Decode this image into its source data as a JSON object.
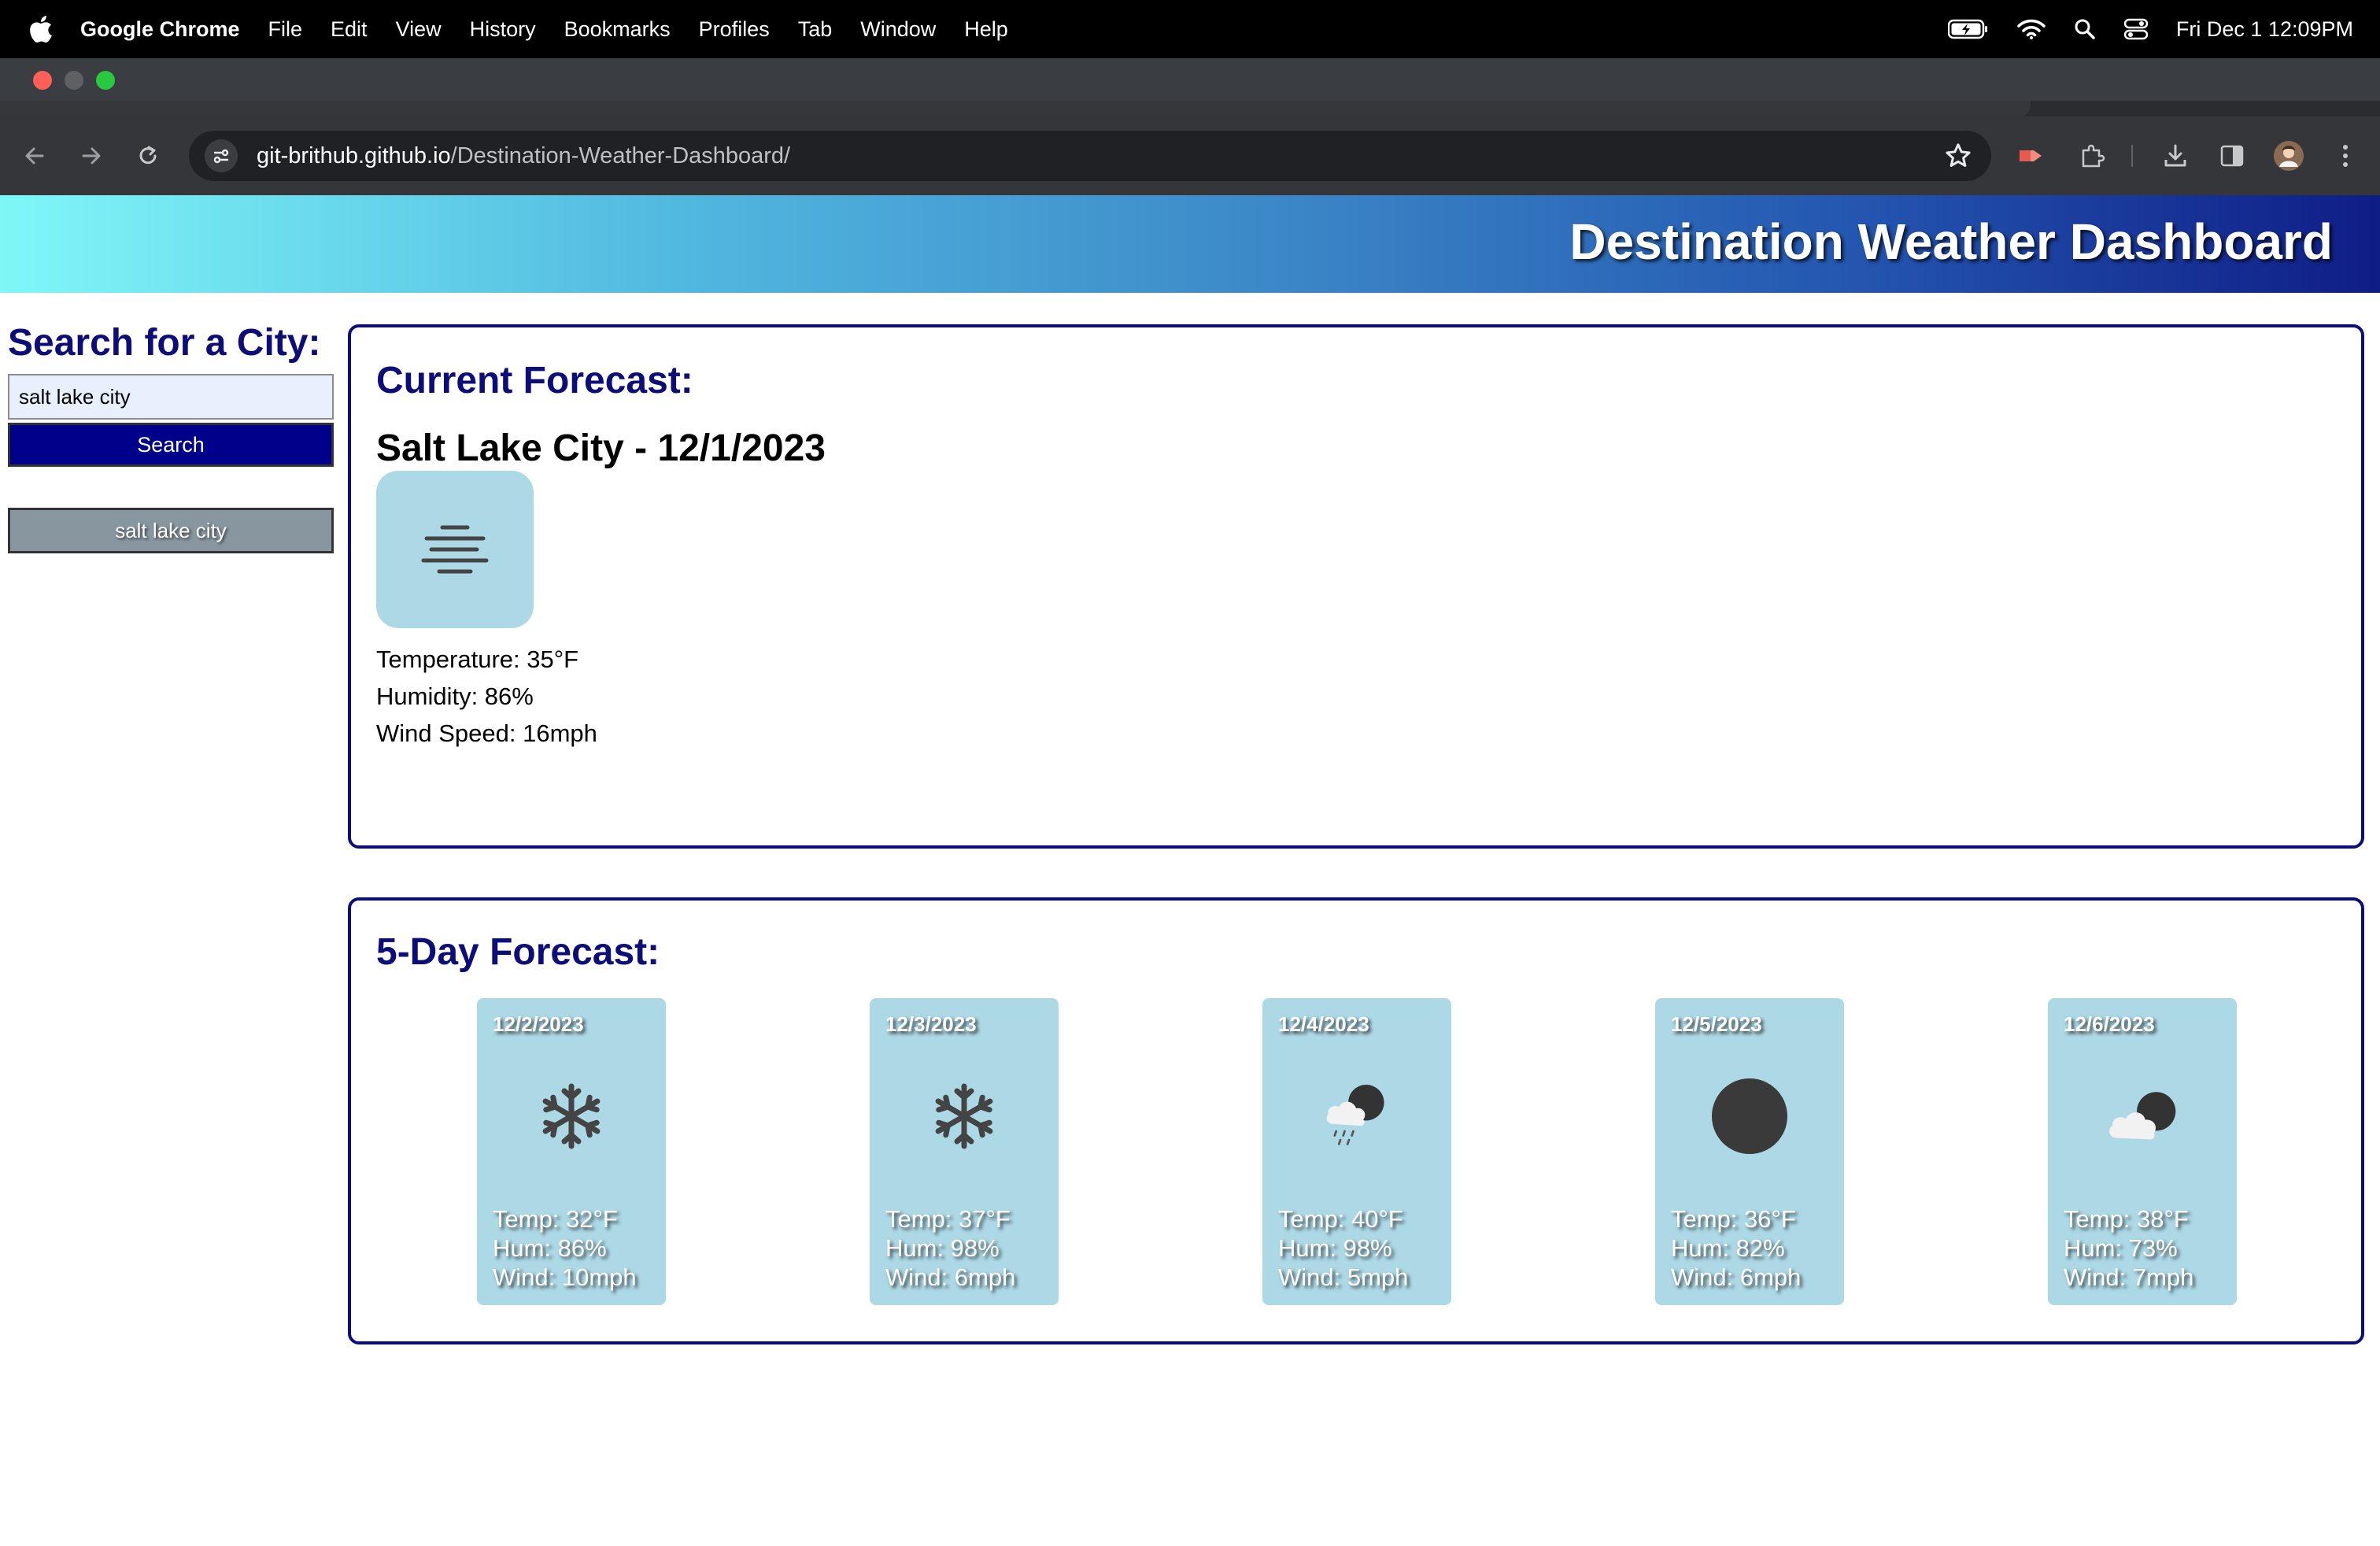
{
  "menubar": {
    "app_name": "Google Chrome",
    "items": [
      "File",
      "Edit",
      "View",
      "History",
      "Bookmarks",
      "Profiles",
      "Tab",
      "Window",
      "Help"
    ],
    "clock": "Fri Dec 1  12:09PM"
  },
  "browser": {
    "url_host": "git-brithub.github.io",
    "url_path": "/Destination-Weather-Dashboard/"
  },
  "page": {
    "title": "Destination Weather Dashboard",
    "search": {
      "heading": "Search for a City:",
      "input_value": "salt lake city",
      "button_label": "Search",
      "history": [
        "salt lake city"
      ]
    },
    "current": {
      "heading": "Current Forecast:",
      "city_date": "Salt Lake City - 12/1/2023",
      "icon": "mist-icon",
      "temperature": "Temperature: 35°F",
      "humidity": "Humidity: 86%",
      "wind": "Wind Speed: 16mph"
    },
    "forecast": {
      "heading": "5-Day Forecast:",
      "days": [
        {
          "date": "12/2/2023",
          "icon": "snow-icon",
          "temp": "Temp: 32°F",
          "hum": "Hum: 86%",
          "wind": "Wind: 10mph"
        },
        {
          "date": "12/3/2023",
          "icon": "snow-icon",
          "temp": "Temp: 37°F",
          "hum": "Hum: 98%",
          "wind": "Wind: 6mph"
        },
        {
          "date": "12/4/2023",
          "icon": "snow-cloud-night-icon",
          "temp": "Temp: 40°F",
          "hum": "Hum: 98%",
          "wind": "Wind: 5mph"
        },
        {
          "date": "12/5/2023",
          "icon": "clear-night-icon",
          "temp": "Temp: 36°F",
          "hum": "Hum: 82%",
          "wind": "Wind: 6mph"
        },
        {
          "date": "12/6/2023",
          "icon": "few-clouds-night-icon",
          "temp": "Temp: 38°F",
          "hum": "Hum: 73%",
          "wind": "Wind: 7mph"
        }
      ]
    }
  },
  "colors": {
    "heading_navy": "#0d0d7a",
    "search_button": "#00008b",
    "card_bg": "#add8e6",
    "history_button": "#8896a0"
  }
}
